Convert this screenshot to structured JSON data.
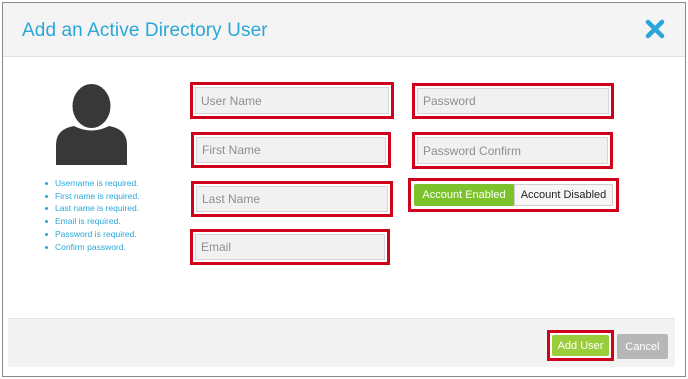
{
  "dialog": {
    "title": "Add an Active Directory User",
    "close_icon": "close-icon"
  },
  "validation": {
    "messages": [
      "Username is required.",
      "First name is required.",
      "Last name is required.",
      "Email is required.",
      "Password is required.",
      "Confirm password."
    ]
  },
  "form": {
    "username_placeholder": "User Name",
    "firstname_placeholder": "First Name",
    "lastname_placeholder": "Last Name",
    "email_placeholder": "Email",
    "password_placeholder": "Password",
    "password_confirm_placeholder": "Password Confirm",
    "account_enabled_label": "Account Enabled",
    "account_disabled_label": "Account Disabled",
    "account_status_selected": "Account Enabled"
  },
  "footer": {
    "add_label": "Add User",
    "cancel_label": "Cancel"
  },
  "colors": {
    "accent": "#2aa7d8",
    "enabled": "#7cc22a",
    "add_button": "#9acd3a",
    "highlight": "#d0021b"
  }
}
